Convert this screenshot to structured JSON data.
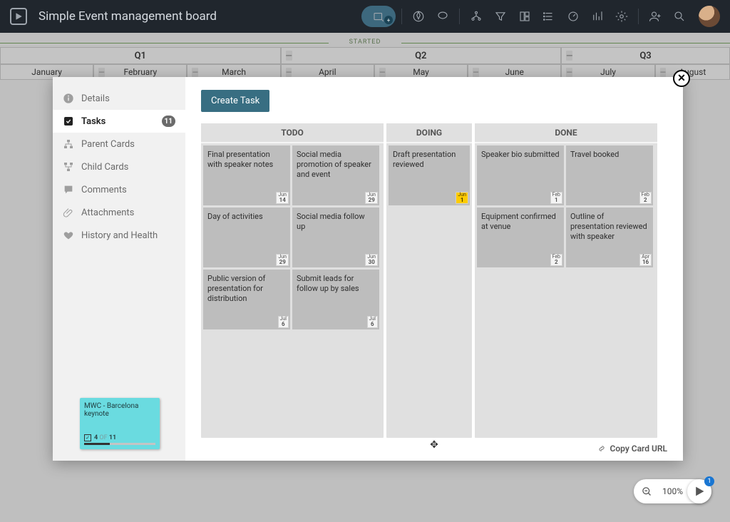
{
  "header": {
    "title": "Simple Event management board",
    "pill_badge": "+"
  },
  "timeline": {
    "started_label": "STARTED",
    "quarters": [
      "Q1",
      "Q2",
      "Q3"
    ],
    "months": [
      "January",
      "February",
      "March",
      "April",
      "May",
      "June",
      "July",
      "August"
    ]
  },
  "sidebar": {
    "items": [
      {
        "label": "Details"
      },
      {
        "label": "Tasks",
        "badge": "11"
      },
      {
        "label": "Parent Cards"
      },
      {
        "label": "Child Cards"
      },
      {
        "label": "Comments"
      },
      {
        "label": "Attachments"
      },
      {
        "label": "History and Health"
      }
    ],
    "mini_card": {
      "title": "MWC - Barcelona keynote",
      "progress_done": "4",
      "progress_of": "OF",
      "progress_total": "11"
    }
  },
  "panel": {
    "create_label": "Create Task",
    "columns": {
      "todo": {
        "title": "TODO",
        "cards": [
          {
            "t": "Final presentation with speaker notes",
            "dm": "Jun",
            "dd": "14"
          },
          {
            "t": "Social media promotion of speaker and event",
            "dm": "Jun",
            "dd": "29"
          },
          {
            "t": "Day of activities",
            "dm": "Jun",
            "dd": "29"
          },
          {
            "t": "Social media follow up",
            "dm": "Jun",
            "dd": "30"
          },
          {
            "t": "Public version of presentation for distribution",
            "dm": "Jul",
            "dd": "6"
          },
          {
            "t": "Submit leads for follow up by sales",
            "dm": "Jul",
            "dd": "6"
          }
        ]
      },
      "doing": {
        "title": "DOING",
        "cards": [
          {
            "t": "Draft presentation reviewed",
            "dm": "Jun",
            "dd": "1",
            "due": true
          }
        ]
      },
      "done": {
        "title": "DONE",
        "cards": [
          {
            "t": "Speaker bio submitted",
            "dm": "Feb",
            "dd": "1"
          },
          {
            "t": "Travel booked",
            "dm": "Feb",
            "dd": "2"
          },
          {
            "t": "Equipment confirmed at venue",
            "dm": "Feb",
            "dd": "2"
          },
          {
            "t": "Outline of presentation reviewed with speaker",
            "dm": "Apr",
            "dd": "16"
          }
        ]
      }
    },
    "copy_url": "Copy Card URL"
  },
  "zoom": {
    "level": "100%",
    "fab_badge": "1"
  }
}
